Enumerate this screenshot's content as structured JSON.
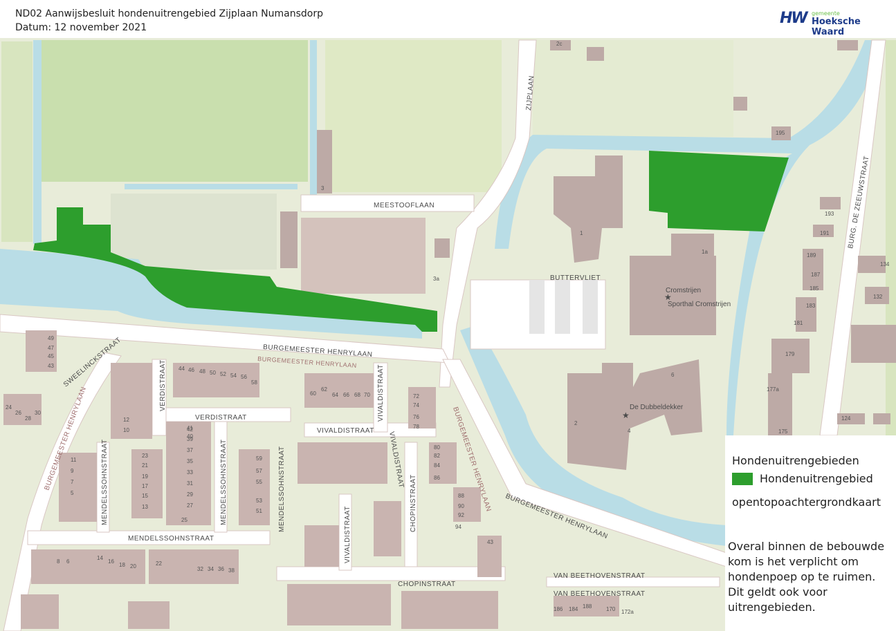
{
  "header": {
    "title": "ND02 Aanwijsbesluit hondenuitrengebied Zijplaan Numansdorp",
    "date": "Datum: 12 november 2021",
    "logo": {
      "small": "gemeente",
      "big": "Hoeksche Waard",
      "mark": "HW"
    }
  },
  "map": {
    "streets": {
      "meestooflaan": "MEESTOOFLAAN",
      "zijplaan": "ZIJPLAAN",
      "buttervliet": "BUTTERVLIET",
      "burg_zeeuwstraat": "BURG. DE ZEEUWSTRAAT",
      "burgemeester_henrylaan": "BURGEMEESTER HENRYLAAN",
      "verdistraat": "VERDISTRAAT",
      "vivaldistraat": "VIVALDISTRAAT",
      "mendelssohnstraat": "MENDELSSOHNSTRAAT",
      "chopinstraat": "CHOPINSTRAAT",
      "van_beethovenstraat": "VAN BEETHOVENSTRAAT",
      "sweelinckstraat": "SWEELINCKSTRAAT"
    },
    "pois": {
      "cromstrijen": "Cromstrijen",
      "sporthal": "Sporthal Cromstrijen",
      "dubbeldekker": "De Dubbeldekker"
    },
    "house_numbers": [
      "2c",
      "195",
      "193",
      "191",
      "189",
      "187",
      "185",
      "183",
      "181",
      "179",
      "177a",
      "175",
      "134",
      "132",
      "124",
      "1a",
      "1",
      "3",
      "6",
      "2",
      "4",
      "3a",
      "49",
      "47",
      "45",
      "43",
      "24",
      "26",
      "28",
      "30",
      "44",
      "46",
      "48",
      "50",
      "52",
      "54",
      "56",
      "58",
      "60",
      "62",
      "64",
      "66",
      "68",
      "70",
      "72",
      "74",
      "76",
      "78",
      "80",
      "82",
      "84",
      "86",
      "88",
      "90",
      "92",
      "94",
      "41",
      "39",
      "37",
      "35",
      "33",
      "31",
      "29",
      "27",
      "25",
      "23",
      "21",
      "19",
      "17",
      "15",
      "13",
      "11",
      "9",
      "7",
      "5",
      "12",
      "10",
      "8",
      "6",
      "14",
      "16",
      "18",
      "20",
      "22",
      "32",
      "34",
      "36",
      "38",
      "40",
      "42",
      "43",
      "186",
      "184",
      "188",
      "170",
      "172a",
      "51",
      "53",
      "55",
      "57",
      "59"
    ]
  },
  "legend": {
    "title": "Hondenuitrengebieden",
    "item": "Hondenuitrengebied",
    "item_color": "#2d9e2d",
    "base": "opentopoachtergrondkaart",
    "note": "Overal binnen de bebouwde kom is het verplicht om hondenpoep op te ruimen. Dit geldt ook voor uitrengebieden."
  }
}
